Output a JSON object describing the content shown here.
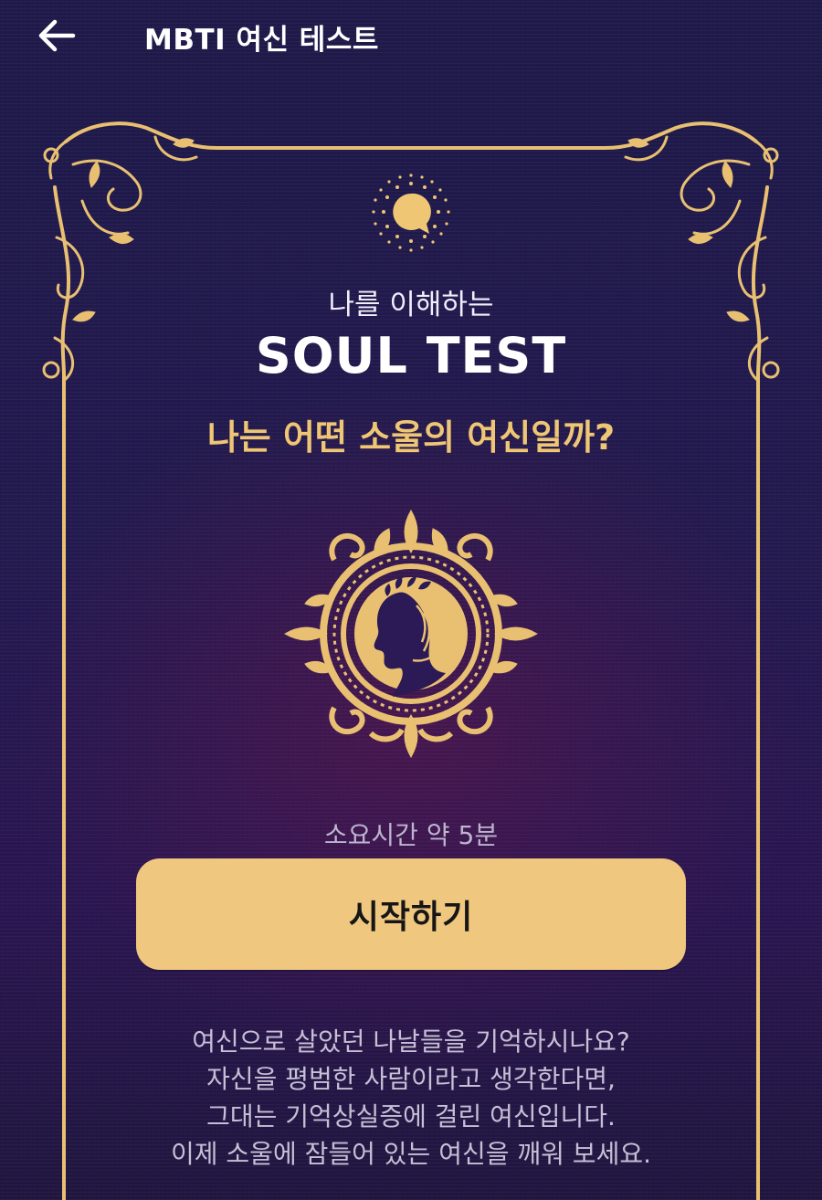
{
  "header": {
    "back_icon": "arrow-left-icon",
    "title": "MBTI 여신 테스트"
  },
  "hero": {
    "logo_icon": "speech-bubble-spark-icon",
    "subtitle": "나를 이해하는",
    "title": "SOUL TEST",
    "question": "나는 어떤 소울의 여신일까?",
    "emblem_icon": "goddess-medallion-icon"
  },
  "test_info": {
    "duration": "소요시간 약 5분"
  },
  "start_button": {
    "label": "시작하기"
  },
  "description": {
    "lines": [
      "여신으로 살았던 나날들을 기억하시나요?",
      "자신을 평범한 사람이라고 생각한다면,",
      "그대는 기억상실증에 걸린 여신입니다.",
      "이제 소울에 잠들어 있는 여신을 깨워 보세요."
    ]
  },
  "colors": {
    "background": "#221a4d",
    "gold": "#e9c071",
    "button": "#f0c77f",
    "button_text": "#161616",
    "muted_text": "#c7bfd6"
  }
}
